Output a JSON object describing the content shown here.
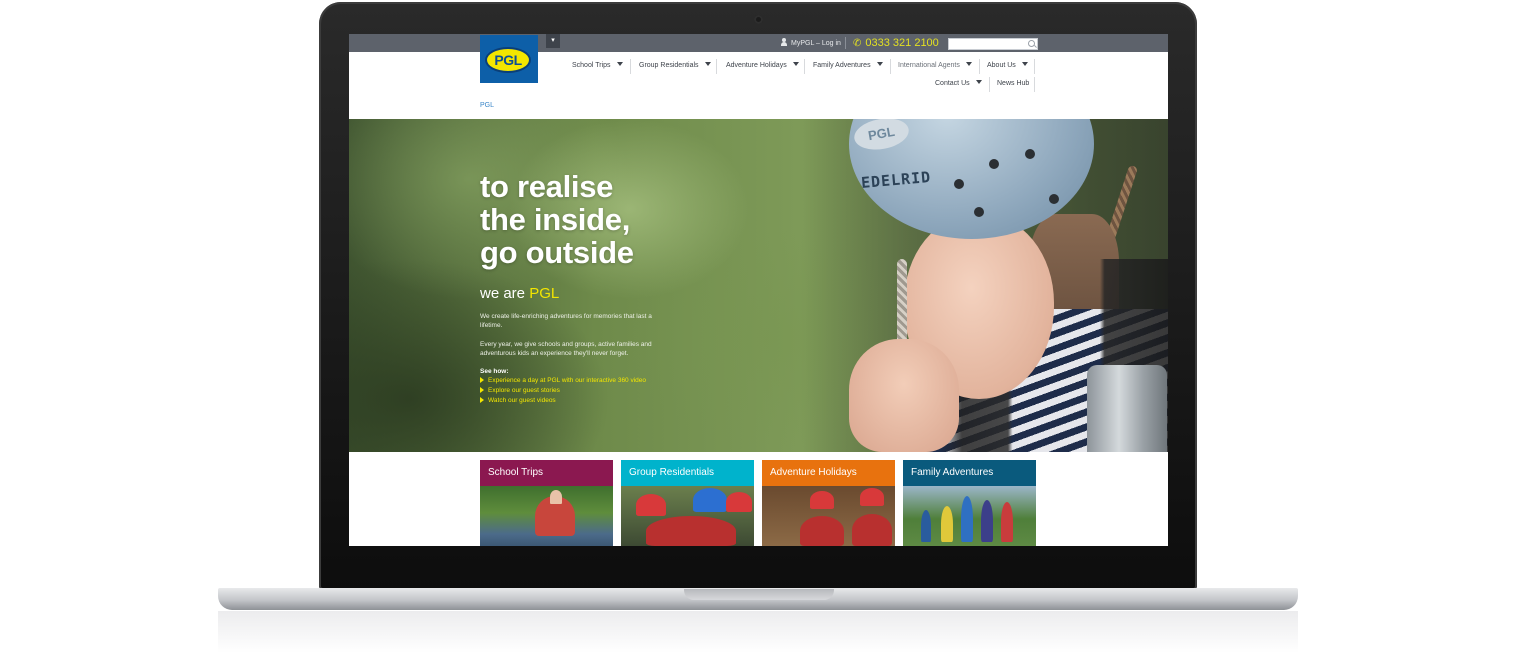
{
  "topbar": {
    "lang_toggle": "▾",
    "mypgl_label": "MyPGL – Log in",
    "phone": "0333 321 2100",
    "search_placeholder": ""
  },
  "logo": {
    "text": "PGL"
  },
  "nav": {
    "items": [
      {
        "label": "School Trips",
        "has_dropdown": true
      },
      {
        "label": "Group Residentials",
        "has_dropdown": true
      },
      {
        "label": "Adventure Holidays",
        "has_dropdown": true
      },
      {
        "label": "Family Adventures",
        "has_dropdown": true
      },
      {
        "label": "International Agents",
        "has_dropdown": true
      },
      {
        "label": "About Us",
        "has_dropdown": true
      },
      {
        "label": "Contact Us",
        "has_dropdown": true
      },
      {
        "label": "News Hub",
        "has_dropdown": false
      }
    ]
  },
  "breadcrumb": {
    "label": "PGL"
  },
  "hero": {
    "headline": "to realise\nthe inside,\ngo outside",
    "subhead_prefix": "we are ",
    "subhead_brand": "PGL",
    "para1": "We create life-enriching adventures for memories that last a lifetime.",
    "para2": "Every year, we give schools and groups, active families and adventurous kids an experience they'll never forget.",
    "see_how": "See how:",
    "links": [
      "Experience a day at PGL with our interactive 360 video",
      "Explore our guest stories",
      "Watch our guest videos"
    ],
    "helmet_text": "EDELRID",
    "helmet_logo": "PGL"
  },
  "tiles": [
    {
      "label": "School Trips",
      "color": "#8b1850"
    },
    {
      "label": "Group Residentials",
      "color": "#00b3cc"
    },
    {
      "label": "Adventure Holidays",
      "color": "#e8720e"
    },
    {
      "label": "Family Adventures",
      "color": "#0a5a7d"
    }
  ],
  "colors": {
    "topbar": "#5d626b",
    "brand_blue": "#0d5fa8",
    "brand_yellow": "#f3e600",
    "link_blue": "#3a86c8"
  }
}
